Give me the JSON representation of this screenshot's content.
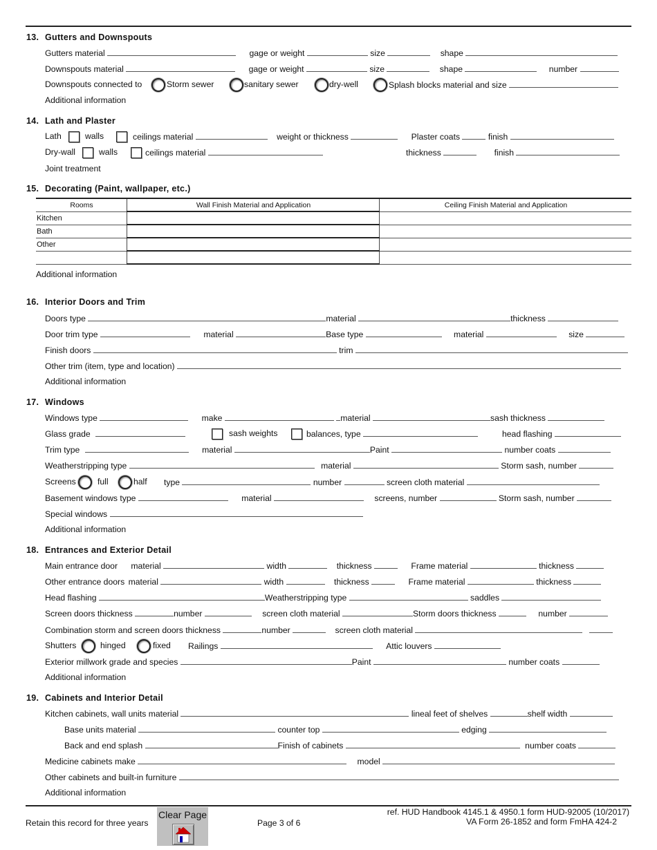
{
  "sections": {
    "s13": {
      "number": "13.",
      "title": "Gutters and Downspouts",
      "row1": {
        "gutters_material": "Gutters material",
        "gage": "gage or weight",
        "size": "size",
        "shape": "shape"
      },
      "row2": {
        "downspouts_material": "Downspouts material",
        "gage": "gage or weight",
        "size": "size",
        "shape": "shape",
        "number": "number"
      },
      "row3": {
        "connected_to": "Downspouts connected to",
        "options": [
          "Storm sewer",
          "sanitary sewer",
          "dry-well",
          "Splash blocks material and size"
        ]
      },
      "additional": "Additional information"
    },
    "s14": {
      "number": "14.",
      "title": "Lath and Plaster",
      "row1": {
        "lath": "Lath",
        "walls": "walls",
        "ceilings_material": "ceilings material",
        "weight": "weight or thickness",
        "plaster_coats": "Plaster  coats",
        "finish": "finish"
      },
      "row2": {
        "drywall": "Dry-wall",
        "walls": "walls",
        "ceilings_material": "ceilings material",
        "thickness": "thickness",
        "finish": "finish"
      },
      "joint": "Joint treatment"
    },
    "s15": {
      "number": "15.",
      "title": "Decorating (Paint, wallpaper, etc.)",
      "table": {
        "headers": [
          "Rooms",
          "Wall Finish Material and Application",
          "Ceiling Finish Material and Application"
        ],
        "rows": [
          {
            "room": "Kitchen",
            "wall": "",
            "ceiling": ""
          },
          {
            "room": "Bath",
            "wall": "",
            "ceiling": ""
          },
          {
            "room": "Other",
            "wall": "",
            "ceiling": ""
          },
          {
            "room": "",
            "wall": "",
            "ceiling": ""
          }
        ]
      },
      "additional": "Additional information"
    },
    "s16": {
      "number": "16.",
      "title": "Interior Doors and Trim",
      "row1": {
        "doors_type": "Doors type",
        "material": "material",
        "thickness": "thickness"
      },
      "row2": {
        "door_trim_type": "Door trim type",
        "material": "material",
        "base_type": "Base type",
        "material2": "material",
        "size": "size"
      },
      "row3": {
        "finish_doors": "Finish doors",
        "trim": "trim"
      },
      "row4": {
        "other_trim": "Other trim (item, type and location)"
      },
      "additional": "Additional information"
    },
    "s17": {
      "number": "17.",
      "title": "Windows",
      "row1": {
        "windows_type": "Windows type",
        "make": "make",
        "material": "material",
        "sash_thickness": "sash thickness"
      },
      "row2": {
        "glass_grade": "Glass grade",
        "sash_weights": "sash weights",
        "balances": "balances, type",
        "head_flashing": "head flashing"
      },
      "row3": {
        "trim_type": "Trim type",
        "material": "material",
        "paint": "Paint",
        "number_coats": "number coats"
      },
      "row4": {
        "weatherstripping": "Weatherstripping type",
        "material": "material",
        "storm_sash": "Storm sash, number"
      },
      "row5": {
        "screens": "Screens",
        "full": "full",
        "half": "half",
        "type": "type",
        "number": "number",
        "screen_cloth": "screen cloth material"
      },
      "row6": {
        "basement": "Basement windows type",
        "material": "material",
        "screens_number": "screens, number",
        "storm_sash": "Storm sash, number"
      },
      "row7": {
        "special": "Special windows"
      },
      "additional": "Additional information"
    },
    "s18": {
      "number": "18.",
      "title": "Entrances and Exterior Detail",
      "row1": {
        "label": "Main entrance door",
        "material": "material",
        "width": "width",
        "thickness": "thickness",
        "frame": "Frame material",
        "thickness2": "thickness"
      },
      "row2": {
        "label": "Other entrance doors",
        "material": "material",
        "width": "width",
        "thickness": "thickness",
        "frame": "Frame material",
        "thickness2": "thickness"
      },
      "row3": {
        "head_flashing": "Head flashing",
        "weatherstripping": "Weatherstripping  type",
        "saddles": "saddles"
      },
      "row4": {
        "screen_doors": "Screen doors  thickness",
        "number": "number",
        "screen_cloth": "screen cloth material",
        "storm_doors": "Storm doors thickness",
        "number2": "number"
      },
      "row5": {
        "combination": "Combination storm and screen doors  thickness",
        "number": "number",
        "screen_cloth": "screen cloth material"
      },
      "row6": {
        "shutters": "Shutters",
        "hinged": "hinged",
        "fixed": "fixed",
        "railings": "Railings",
        "attic": "Attic louvers"
      },
      "row7": {
        "millwork": "Exterior millwork  grade and species",
        "paint": "Paint",
        "number_coats": "number coats"
      },
      "additional": "Additional information"
    },
    "s19": {
      "number": "19.",
      "title": "Cabinets and Interior Detail",
      "row1": {
        "kitchen": "Kitchen cabinets, wall units material",
        "lineal": "lineal feet of shelves",
        "shelf_width": "shelf width"
      },
      "row2": {
        "base": "Base units material",
        "counter": "counter top",
        "edging": "edging"
      },
      "row3": {
        "splash": "Back and end splash",
        "finish": "Finish of cabinets",
        "coats": "number coats"
      },
      "row4": {
        "medicine": "Medicine cabinets make",
        "model": "model"
      },
      "row5": {
        "other": "Other cabinets and built-in furniture"
      },
      "additional": "Additional information"
    }
  },
  "footer": {
    "retain": "Retain this record for three years",
    "clear_page": "Clear Page",
    "page": "Page  3 of 6",
    "ref_line1": "ref. HUD Handbook 4145.1 & 4950.1  form HUD-92005 (10/2017)",
    "ref_line2": "VA Form 26-1852 and form FmHA 424-2"
  },
  "colors": {
    "house_roof": "#cc0000",
    "house_door": "#0000aa",
    "button_bg": "#c0c0c0"
  }
}
